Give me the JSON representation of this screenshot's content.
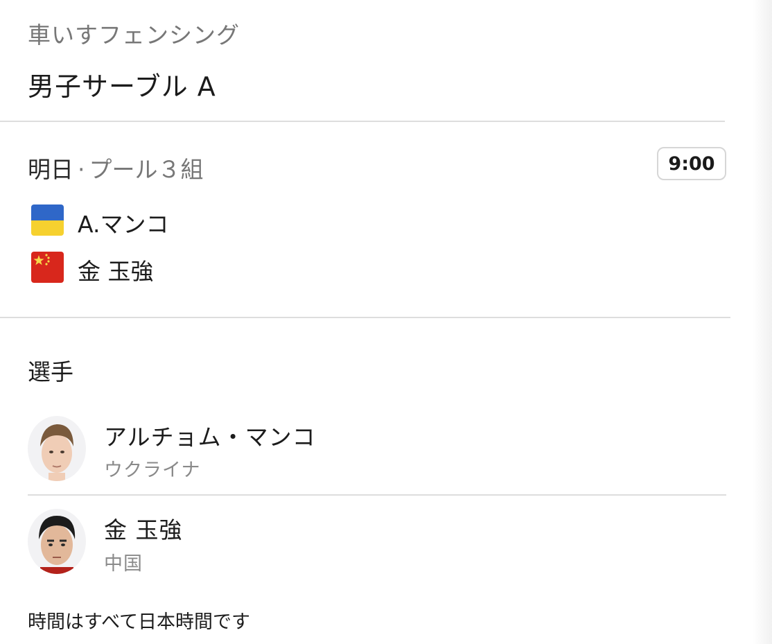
{
  "header": {
    "sport": "車いすフェンシング",
    "event": "男子サーブル A"
  },
  "match": {
    "day": "明日",
    "separator": "·",
    "pool": "プール３組",
    "time": "9:00",
    "competitors": [
      {
        "flag": "ukraine-flag",
        "name": "A.マンコ"
      },
      {
        "flag": "china-flag",
        "name": "金 玉強"
      }
    ]
  },
  "athletes": {
    "title": "選手",
    "list": [
      {
        "name": "アルチョム・マンコ",
        "country": "ウクライナ"
      },
      {
        "name": "金 玉強",
        "country": "中国"
      }
    ]
  },
  "footer": {
    "note": "時間はすべて日本時間です"
  },
  "colors": {
    "ukraine_blue": "#2f67c8",
    "ukraine_yellow": "#f6d12f",
    "china_red": "#d8271c",
    "china_star": "#f7d94a"
  }
}
